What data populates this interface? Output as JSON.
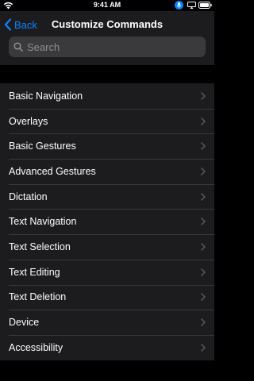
{
  "status_bar": {
    "time": "9:41 AM",
    "icons": [
      "wifi-icon",
      "microphone-icon",
      "screen-mirroring-icon",
      "battery-icon"
    ]
  },
  "nav": {
    "back_label": "Back",
    "title": "Customize Commands",
    "back_icon": "chevron-left-icon"
  },
  "search": {
    "placeholder": "Search",
    "value": "",
    "icon": "search-icon"
  },
  "colors": {
    "accent": "#0a84ff",
    "background": "#000000",
    "surface": "#1c1c1e",
    "search_field": "#3a3a3c",
    "secondary_text": "#8e8e93"
  },
  "list": {
    "items": [
      {
        "label": "Basic Navigation"
      },
      {
        "label": "Overlays"
      },
      {
        "label": "Basic Gestures"
      },
      {
        "label": "Advanced Gestures"
      },
      {
        "label": "Dictation"
      },
      {
        "label": "Text Navigation"
      },
      {
        "label": "Text Selection"
      },
      {
        "label": "Text Editing"
      },
      {
        "label": "Text Deletion"
      },
      {
        "label": "Device"
      },
      {
        "label": "Accessibility"
      }
    ]
  }
}
